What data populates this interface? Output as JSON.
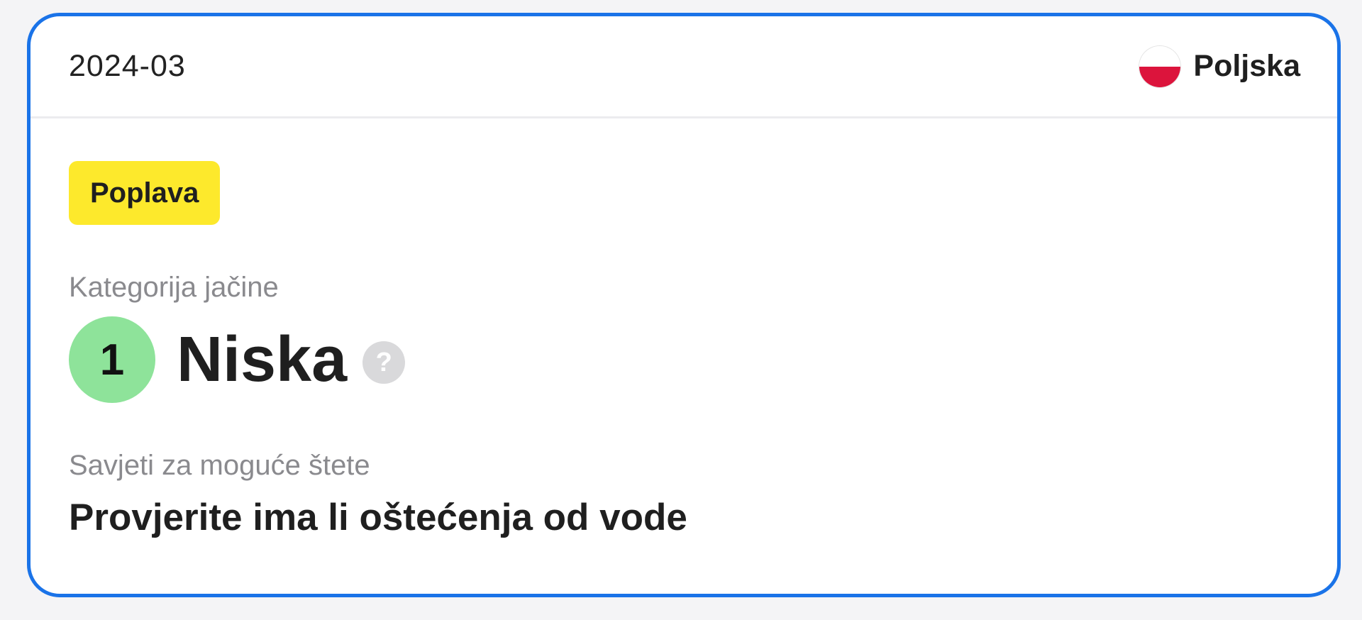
{
  "card": {
    "date": "2024-03",
    "country": {
      "name": "Poljska",
      "flag_icon": "poland-flag-icon",
      "flag_colors": [
        "#ffffff",
        "#dc143c"
      ]
    },
    "event_badge": {
      "label": "Poplava",
      "color": "#fde92c"
    },
    "severity": {
      "heading": "Kategorija jačine",
      "level": "1",
      "level_color": "#8ee39a",
      "text": "Niska",
      "help_icon": "question-mark-icon",
      "help_glyph": "?"
    },
    "advice": {
      "heading": "Savjeti za moguće štete",
      "text": "Provjerite ima li oštećenja od vode"
    },
    "accent_color": "#1a73e8"
  }
}
